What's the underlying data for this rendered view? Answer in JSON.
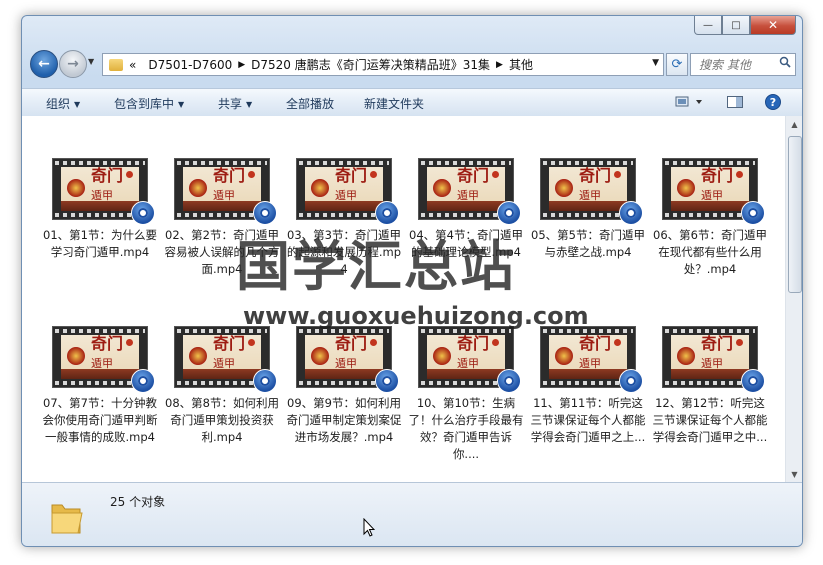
{
  "window": {
    "caption": {
      "minimize": "—",
      "maximize": "□",
      "close": "✕"
    }
  },
  "nav": {
    "back_icon": "back-arrow-icon",
    "forward_icon": "forward-arrow-icon",
    "breadcrumb": [
      "«",
      "D7501-D7600",
      "D7520 唐鹏志《奇门运筹决策精品班》31集",
      "其他"
    ],
    "search_placeholder": "搜索 其他"
  },
  "toolbar": {
    "organize": "组织",
    "include_library": "包含到库中",
    "share": "共享",
    "play_all": "全部播放",
    "new_folder": "新建文件夹"
  },
  "files": [
    {
      "name": "01、第1节：为什么要学习奇门遁甲.mp4"
    },
    {
      "name": "02、第2节：奇门遁甲容易被人误解的几个方面.mp4"
    },
    {
      "name": "03、第3节：奇门遁甲的起源和发展历程.mp4"
    },
    {
      "name": "04、第4节：奇门遁甲的基础理论模型.mp4"
    },
    {
      "name": "05、第5节：奇门遁甲与赤壁之战.mp4"
    },
    {
      "name": "06、第6节：奇门遁甲在现代都有些什么用处？.mp4"
    },
    {
      "name": "07、第7节：十分钟教会你使用奇门遁甲判断一般事情的成败.mp4"
    },
    {
      "name": "08、第8节：如何利用奇门遁甲策划投资获利.mp4"
    },
    {
      "name": "09、第9节：如何利用奇门遁甲制定策划案促进市场发展？.mp4"
    },
    {
      "name": "10、第10节：生病了！什么治疗手段最有效？奇门遁甲告诉你...."
    },
    {
      "name": "11、第11节：听完这三节课保证每个人都能学得会奇门遁甲之上..."
    },
    {
      "name": "12、第12节：听完这三节课保证每个人都能学得会奇门遁甲之中..."
    }
  ],
  "thumbnail": {
    "glyph": "奇门",
    "sub": "遁甲"
  },
  "watermark": {
    "cn": "国学汇总站",
    "en": "www.guoxuehuizong.com"
  },
  "status": {
    "count": "25 个对象"
  }
}
